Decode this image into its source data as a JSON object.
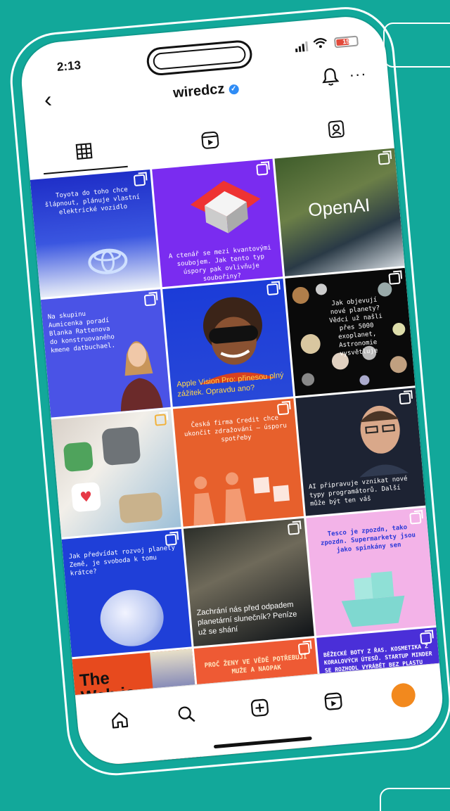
{
  "status": {
    "time": "2:13",
    "battery": "15"
  },
  "header": {
    "username": "wiredcz"
  },
  "colors": {
    "background": "#12a89a",
    "accent": "#2f8cf5",
    "profile": "#f2891e"
  },
  "icons": {
    "back": "chevron-left-icon",
    "bell": "bell-icon",
    "more": "more-horizontal-icon",
    "grid": "grid-icon",
    "reels": "reels-icon",
    "tagged": "tagged-icon",
    "home": "home-icon",
    "search": "search-icon",
    "create": "plus-square-icon",
    "reels_nav": "reels-icon"
  },
  "posts": [
    {
      "caption": "Toyota do toho chce šlápnout, plánuje vlastní elektrické vozidlo"
    },
    {
      "caption": "A ctenář se mezi kvantovými soubojem. Jak tento typ úspory pak ovlivňuje soubořiny?"
    },
    {
      "caption": "OpenAI"
    },
    {
      "caption": "Na skupinu Aumicenka poradí Blanka Rattenova do konstruovaného kmene datbuchael."
    },
    {
      "caption": "Apple Vision Pro: přinesou plný zážitek. Opravdu ano?"
    },
    {
      "caption": "Jak objevují nové planety? Vědci už našli přes 5000 exoplanet, Astronomie vysvětluje"
    },
    {
      "caption": ""
    },
    {
      "caption": "Česká firma Credit chce ukončit zdražování — úsporu spotřeby"
    },
    {
      "caption": "AI připravuje vznikat nové typy programátorů. Další může být ten váš"
    },
    {
      "caption": "Jak předvídat rozvoj planety Země, je svoboda k tomu krátce?"
    },
    {
      "caption": "Zachrání nás před odpadem planetární slunečník? Peníze už se shání"
    },
    {
      "caption": "Tesco je zpozdn, tako zpozdn. Supermarkety jsou jako spinkány sen"
    },
    {
      "caption": "The Web is dead."
    },
    {
      "caption": "PROČ ŽENY VE VĚDĚ POTŘEBUJÍ MUŽE A NAOPAK"
    },
    {
      "caption": "BĚŽECKÉ BOTY Z ŘAS. KOSMETIKA Z KORALOVÝCH ÚTESŮ. STARTUP MINDER SE ROZHODL VYRÁBĚT BEZ PLASTU"
    }
  ]
}
